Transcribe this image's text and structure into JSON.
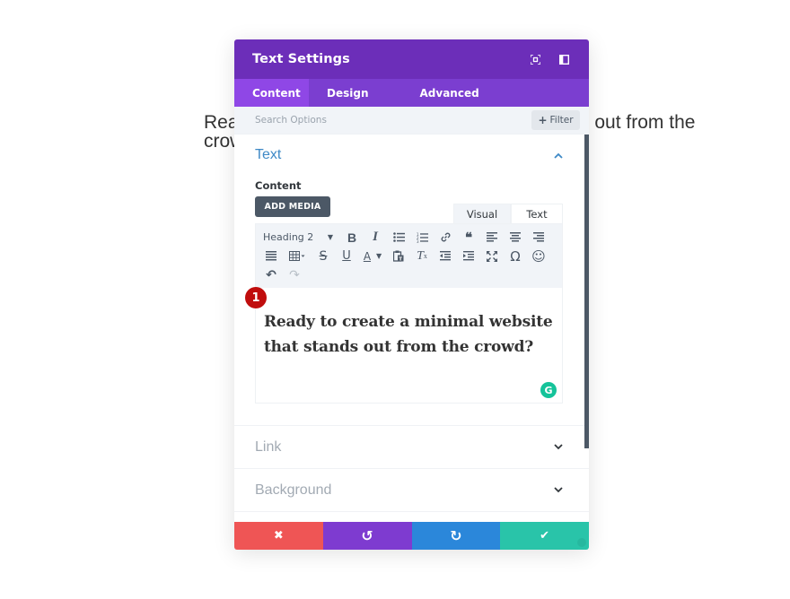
{
  "background": {
    "line1": "Ready to create a minimal website that stands out from the",
    "line2": "crowd?"
  },
  "modal": {
    "title": "Text Settings",
    "header_icons": [
      "expand-icon",
      "sidebar-toggle-icon"
    ],
    "tabs": [
      {
        "label": "Content",
        "active": true
      },
      {
        "label": "Design",
        "active": false
      },
      {
        "label": "Advanced",
        "active": false
      }
    ],
    "search": {
      "placeholder": "Search Options",
      "filter_label": "Filter"
    },
    "sections": {
      "text": {
        "title": "Text",
        "content_label": "Content",
        "add_media_label": "ADD MEDIA",
        "mode_tabs": {
          "visual": "Visual",
          "text": "Text"
        },
        "format_select": "Heading 2",
        "badge": "1",
        "editor_content": "Ready to create a minimal website that stands out from the crowd?",
        "grammarly": "G"
      },
      "link": {
        "title": "Link"
      },
      "background": {
        "title": "Background"
      }
    },
    "footer": {
      "discard": "✖",
      "undo": "↺",
      "redo": "↻",
      "save": "✔"
    }
  },
  "colors": {
    "header": "#6c2eb9",
    "tabs": "#7b3ed0",
    "active_tab": "#8f47e6",
    "discard": "#ef5555",
    "undo": "#7e3bd0",
    "redo": "#2b87da",
    "save": "#29c4a9",
    "section_title": "#3e89c6"
  }
}
